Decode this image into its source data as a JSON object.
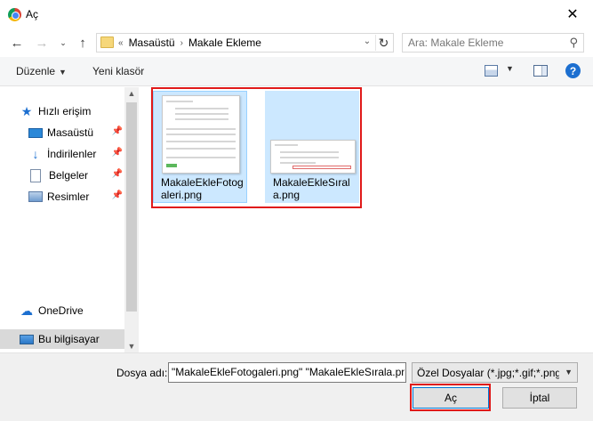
{
  "window": {
    "title": "Aç",
    "close_label": "✕"
  },
  "nav": {
    "back_icon": "back-arrow-icon",
    "forward_icon": "forward-arrow-icon",
    "recent_icon": "chevron-down-icon",
    "up_icon": "up-arrow-icon"
  },
  "address": {
    "prefix": "«",
    "crumbs": [
      "Masaüstü",
      "Makale Ekleme"
    ],
    "separator": "›"
  },
  "search": {
    "placeholder": "Ara: Makale Ekleme"
  },
  "toolbar": {
    "organize_label": "Düzenle",
    "new_folder_label": "Yeni klasör",
    "help_label": "?"
  },
  "sidebar": {
    "items": [
      {
        "label": "Hızlı erişim",
        "icon": "star-icon"
      },
      {
        "label": "Masaüstü",
        "icon": "desktop-icon",
        "pinned": true
      },
      {
        "label": "İndirilenler",
        "icon": "download-icon",
        "pinned": true
      },
      {
        "label": "Belgeler",
        "icon": "documents-icon",
        "pinned": true
      },
      {
        "label": "Resimler",
        "icon": "pictures-icon",
        "pinned": true
      },
      {
        "label": "OneDrive",
        "icon": "cloud-icon"
      },
      {
        "label": "Bu bilgisayar",
        "icon": "computer-icon",
        "selected": true
      }
    ]
  },
  "files": [
    {
      "name": "MakaleEkleFotogaleri.png",
      "selected": true
    },
    {
      "name": "MakaleEkleSırala.png",
      "selected": true
    }
  ],
  "footer": {
    "filename_label": "Dosya adı:",
    "filename_value": "\"MakaleEkleFotogaleri.png\" \"MakaleEkleSırala.png\"",
    "filter_value": "Özel Dosyalar (*.jpg;*.gif;*.png;",
    "open_label": "Aç",
    "cancel_label": "İptal"
  },
  "colors": {
    "selection": "#cce8ff",
    "highlight_border": "#e01a1a",
    "accent": "#0078d7"
  }
}
